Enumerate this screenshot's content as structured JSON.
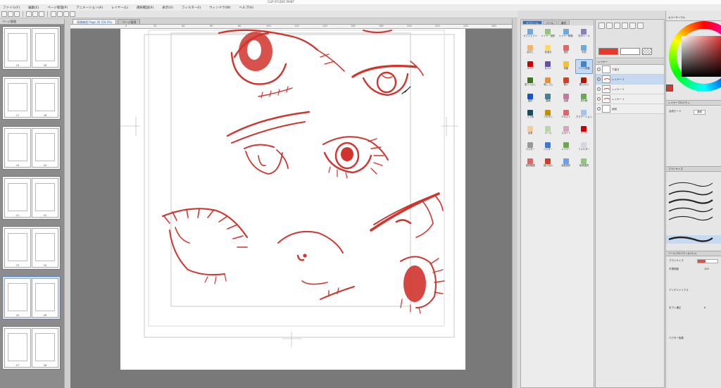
{
  "window": {
    "title": "CLIP STUDIO PAINT"
  },
  "menu": [
    "ファイル(F)",
    "編集(E)",
    "ページ管理(P)",
    "アニメーション(A)",
    "レイヤー(L)",
    "選択範囲(S)",
    "表示(V)",
    "フィルター(I)",
    "ウィンドウ(W)",
    "ヘルプ(H)"
  ],
  "toolbar": {
    "icons": [
      "new-icon",
      "open-icon",
      "save-icon",
      "undo-icon",
      "redo-icon",
      "clear-icon",
      "transform-icon",
      "snap-icon",
      "ruler-icon",
      "grid-icon"
    ]
  },
  "document_tab": {
    "label": "表情練習 Page 26 (50.0%)"
  },
  "document_tab2": {
    "label": "ページ管理"
  },
  "ruler": {
    "ticks": [
      "0",
      "20",
      "40",
      "60",
      "80",
      "100",
      "120",
      "140",
      "160",
      "180",
      "200",
      "220",
      "240",
      "260"
    ]
  },
  "pages_panel": {
    "header": "ページ管理",
    "spreads": [
      {
        "left": "15",
        "right": "16",
        "selected": false
      },
      {
        "left": "17",
        "right": "18",
        "selected": false
      },
      {
        "left": "19",
        "right": "20",
        "selected": false
      },
      {
        "left": "21",
        "right": "22",
        "selected": false
      },
      {
        "left": "23",
        "right": "24",
        "selected": false
      },
      {
        "left": "25",
        "right": "26",
        "selected": true
      },
      {
        "left": "27",
        "right": "28",
        "selected": false
      }
    ]
  },
  "tool_panel": {
    "tabs": [
      "サブツール",
      "ツール",
      "素材"
    ],
    "items": [
      {
        "label": "オブジェクト",
        "color": "#6fa8dc"
      },
      {
        "label": "レイヤー選択",
        "color": "#93c47d"
      },
      {
        "label": "レイヤー移動",
        "color": "#6fa8dc"
      },
      {
        "label": "矢印ツール",
        "color": "#8e7cc3"
      },
      {
        "label": "ぼかし",
        "color": "#f6b26b"
      },
      {
        "label": "色混ぜ",
        "color": "#ffd966"
      },
      {
        "label": "指先",
        "color": "#e06666"
      },
      {
        "label": "水彩",
        "color": "#6fa8dc"
      },
      {
        "label": "Gペン",
        "color": "#cc0000"
      },
      {
        "label": "丸ペン",
        "color": "#674ea7"
      },
      {
        "label": "鉛筆",
        "color": "#f1c232"
      },
      {
        "label": "リアル鉛筆",
        "color": "#3d85c6"
      },
      {
        "label": "塗りつぶし",
        "color": "#38761d"
      },
      {
        "label": "消しゴム",
        "color": "#e69138"
      },
      {
        "label": "硬い",
        "color": "#cc4125"
      },
      {
        "label": "柔らかい",
        "color": "#a61c00"
      },
      {
        "label": "図形",
        "color": "#1155cc"
      },
      {
        "label": "直線",
        "color": "#45818e"
      },
      {
        "label": "曲線",
        "color": "#c27ba0"
      },
      {
        "label": "折れ線",
        "color": "#6aa84f"
      },
      {
        "label": "コマ枠",
        "color": "#134f5c"
      },
      {
        "label": "フキダシ",
        "color": "#bf9000"
      },
      {
        "label": "テキスト",
        "color": "#e06666"
      },
      {
        "label": "グラデーション",
        "color": "#9fc5e8"
      },
      {
        "label": "定規",
        "color": "#f9cb9c"
      },
      {
        "label": "パース",
        "color": "#b6d7a8"
      },
      {
        "label": "スポイト",
        "color": "#d5a6bd"
      },
      {
        "label": "トーン",
        "color": "#cc0000"
      },
      {
        "label": "ラスター",
        "color": "#999999"
      },
      {
        "label": "ベクター",
        "color": "#3c78d8"
      },
      {
        "label": "レイヤー",
        "color": "#6aa84f"
      },
      {
        "label": "フォルダー",
        "color": "#d9d2e9"
      },
      {
        "label": "選択範囲",
        "color": "#e06666"
      },
      {
        "label": "投げなわ",
        "color": "#cc4125"
      },
      {
        "label": "自動選択",
        "color": "#6d9eeb"
      },
      {
        "label": "色域選択",
        "color": "#93c47d"
      }
    ]
  },
  "layers": {
    "header": "レイヤー",
    "rows": [
      {
        "name": "用紙",
        "selected": false
      },
      {
        "name": "レイヤー 1",
        "selected": false
      },
      {
        "name": "レイヤー 2",
        "selected": false
      },
      {
        "name": "レイヤー 3",
        "selected": true
      },
      {
        "name": "下描き",
        "selected": false
      }
    ]
  },
  "right_panel": {
    "color_header": "カラーサークル",
    "main_color": "#d23a2e",
    "props_header": "レイヤープロパティ",
    "blend_label": "合成モード",
    "blend_value": "通常",
    "brush_header": "ブラシサイズ",
    "detail_header": "ツールプロパティ[Gペン]",
    "brush_size_label": "ブラシサイズ",
    "brush_size_value": "6.0",
    "opacity_label": "不透明度",
    "opacity_value": "100",
    "aa_label": "アンチエイリアス",
    "stabilize_label": "手ブレ補正",
    "stabilize_value": "6",
    "vector_label": "ベクター吸着"
  },
  "navigator": {
    "icons": [
      "zoom-in-icon",
      "zoom-out-icon",
      "fit-icon",
      "rotate-left-icon",
      "rotate-right-icon",
      "flip-icon"
    ],
    "swatch_colors": [
      "#e8392c",
      "#ffffff",
      "#000000"
    ]
  },
  "colors": {
    "accent": "#3b6fb4",
    "ink": "#d0342c",
    "selection": "#c5d9f1"
  }
}
